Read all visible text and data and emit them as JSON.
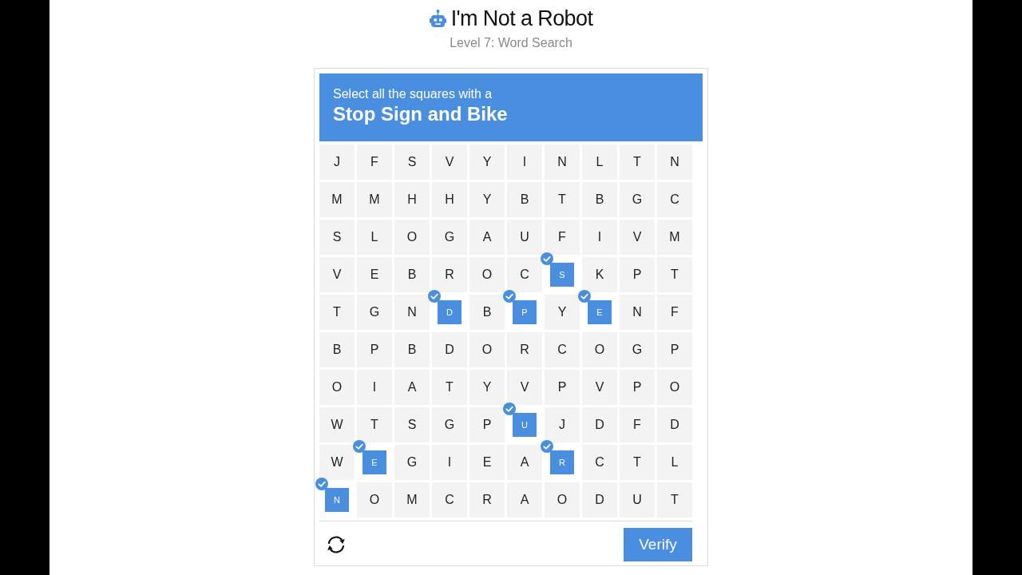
{
  "header": {
    "title": "I'm Not a Robot",
    "subtitle": "Level 7: Word Search"
  },
  "captcha": {
    "prompt": "Select all the squares with a",
    "target": "Stop Sign and Bike",
    "grid": [
      [
        {
          "letter": "J",
          "selected": false
        },
        {
          "letter": "F",
          "selected": false
        },
        {
          "letter": "S",
          "selected": false
        },
        {
          "letter": "V",
          "selected": false
        },
        {
          "letter": "Y",
          "selected": false
        },
        {
          "letter": "I",
          "selected": false
        },
        {
          "letter": "N",
          "selected": false
        },
        {
          "letter": "L",
          "selected": false
        },
        {
          "letter": "T",
          "selected": false
        },
        {
          "letter": "N",
          "selected": false
        }
      ],
      [
        {
          "letter": "M",
          "selected": false
        },
        {
          "letter": "M",
          "selected": false
        },
        {
          "letter": "H",
          "selected": false
        },
        {
          "letter": "H",
          "selected": false
        },
        {
          "letter": "Y",
          "selected": false
        },
        {
          "letter": "B",
          "selected": false
        },
        {
          "letter": "T",
          "selected": false
        },
        {
          "letter": "B",
          "selected": false
        },
        {
          "letter": "G",
          "selected": false
        },
        {
          "letter": "C",
          "selected": false
        }
      ],
      [
        {
          "letter": "S",
          "selected": false
        },
        {
          "letter": "L",
          "selected": false
        },
        {
          "letter": "O",
          "selected": false
        },
        {
          "letter": "G",
          "selected": false
        },
        {
          "letter": "A",
          "selected": false
        },
        {
          "letter": "U",
          "selected": false
        },
        {
          "letter": "F",
          "selected": false
        },
        {
          "letter": "I",
          "selected": false
        },
        {
          "letter": "V",
          "selected": false
        },
        {
          "letter": "M",
          "selected": false
        }
      ],
      [
        {
          "letter": "V",
          "selected": false
        },
        {
          "letter": "E",
          "selected": false
        },
        {
          "letter": "B",
          "selected": false
        },
        {
          "letter": "R",
          "selected": false
        },
        {
          "letter": "O",
          "selected": false
        },
        {
          "letter": "C",
          "selected": false
        },
        {
          "letter": "S",
          "selected": true
        },
        {
          "letter": "K",
          "selected": false
        },
        {
          "letter": "P",
          "selected": false
        },
        {
          "letter": "T",
          "selected": false
        }
      ],
      [
        {
          "letter": "T",
          "selected": false
        },
        {
          "letter": "G",
          "selected": false
        },
        {
          "letter": "N",
          "selected": false
        },
        {
          "letter": "D",
          "selected": true
        },
        {
          "letter": "B",
          "selected": false
        },
        {
          "letter": "P",
          "selected": true
        },
        {
          "letter": "Y",
          "selected": false
        },
        {
          "letter": "E",
          "selected": true
        },
        {
          "letter": "N",
          "selected": false
        },
        {
          "letter": "F",
          "selected": false
        }
      ],
      [
        {
          "letter": "B",
          "selected": false
        },
        {
          "letter": "P",
          "selected": false
        },
        {
          "letter": "B",
          "selected": false
        },
        {
          "letter": "D",
          "selected": false
        },
        {
          "letter": "O",
          "selected": false
        },
        {
          "letter": "R",
          "selected": false
        },
        {
          "letter": "C",
          "selected": false
        },
        {
          "letter": "O",
          "selected": false
        },
        {
          "letter": "G",
          "selected": false
        },
        {
          "letter": "P",
          "selected": false
        }
      ],
      [
        {
          "letter": "O",
          "selected": false
        },
        {
          "letter": "I",
          "selected": false
        },
        {
          "letter": "A",
          "selected": false
        },
        {
          "letter": "T",
          "selected": false
        },
        {
          "letter": "Y",
          "selected": false
        },
        {
          "letter": "V",
          "selected": false
        },
        {
          "letter": "P",
          "selected": false
        },
        {
          "letter": "V",
          "selected": false
        },
        {
          "letter": "P",
          "selected": false
        },
        {
          "letter": "O",
          "selected": false
        }
      ],
      [
        {
          "letter": "W",
          "selected": false
        },
        {
          "letter": "T",
          "selected": false
        },
        {
          "letter": "S",
          "selected": false
        },
        {
          "letter": "G",
          "selected": false
        },
        {
          "letter": "P",
          "selected": false
        },
        {
          "letter": "U",
          "selected": true
        },
        {
          "letter": "J",
          "selected": false
        },
        {
          "letter": "D",
          "selected": false
        },
        {
          "letter": "F",
          "selected": false
        },
        {
          "letter": "D",
          "selected": false
        }
      ],
      [
        {
          "letter": "W",
          "selected": false
        },
        {
          "letter": "E",
          "selected": true
        },
        {
          "letter": "G",
          "selected": false
        },
        {
          "letter": "I",
          "selected": false
        },
        {
          "letter": "E",
          "selected": false
        },
        {
          "letter": "A",
          "selected": false
        },
        {
          "letter": "R",
          "selected": true
        },
        {
          "letter": "C",
          "selected": false
        },
        {
          "letter": "T",
          "selected": false
        },
        {
          "letter": "L",
          "selected": false
        }
      ],
      [
        {
          "letter": "N",
          "selected": true
        },
        {
          "letter": "O",
          "selected": false
        },
        {
          "letter": "M",
          "selected": false
        },
        {
          "letter": "C",
          "selected": false
        },
        {
          "letter": "R",
          "selected": false
        },
        {
          "letter": "A",
          "selected": false
        },
        {
          "letter": "O",
          "selected": false
        },
        {
          "letter": "D",
          "selected": false
        },
        {
          "letter": "U",
          "selected": false
        },
        {
          "letter": "T",
          "selected": false
        }
      ]
    ],
    "verify_button": "Verify"
  }
}
